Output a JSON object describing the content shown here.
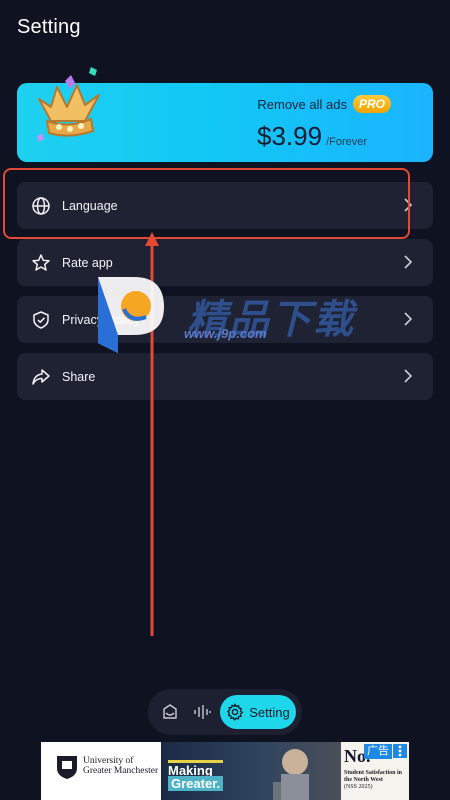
{
  "header": {
    "title": "Setting"
  },
  "pro": {
    "remove_ads": "Remove all ads",
    "badge": "PRO",
    "price": "$3.99",
    "period": "/Forever"
  },
  "settings": {
    "items": [
      {
        "label": "Language",
        "icon": "globe-icon"
      },
      {
        "label": "Rate app",
        "icon": "star-icon"
      },
      {
        "label": "Privacy Policy",
        "icon": "shield-check-icon"
      },
      {
        "label": "Share",
        "icon": "share-icon"
      }
    ]
  },
  "watermark": {
    "chinese": "精品下载",
    "url": "www.j9p.com"
  },
  "nav": {
    "items": [
      {
        "icon": "inbox-icon"
      },
      {
        "icon": "waveform-icon"
      },
      {
        "icon": "gear-icon",
        "label": "Setting"
      }
    ]
  },
  "ad": {
    "uni_name": "University of Greater Manchester",
    "headline_1": "Making",
    "headline_2": "Greater.",
    "right_title": "No.",
    "right_text": "Student Satisfaction in the North West",
    "right_sub": "(NSS 2025)",
    "tag": "广告"
  },
  "colors": {
    "background": "#0f1220",
    "card": "#1f2232",
    "accent": "#1fd7ea",
    "highlight": "#e24a33"
  }
}
